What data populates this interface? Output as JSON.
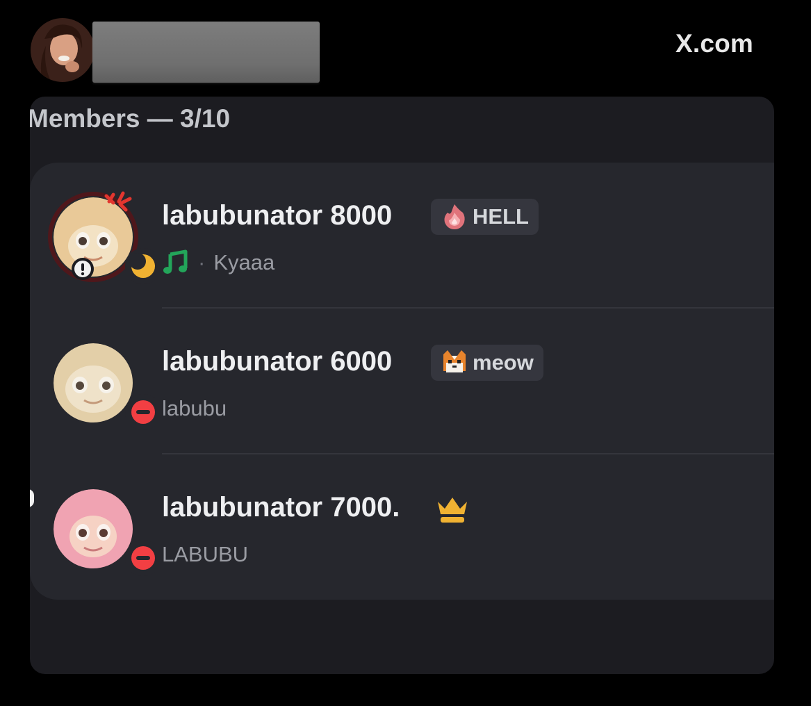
{
  "header": {
    "site_label": "X.com"
  },
  "members_panel": {
    "heading": "Members — 3/10",
    "members": [
      {
        "name": "labubunator 8000",
        "tag": "HELL",
        "tag_icon": "fire-icon",
        "activity_icon": "music-note-icon",
        "status": "Kyaaa",
        "presence": "idle",
        "avatar_color": "#e9c998"
      },
      {
        "name": "labubunator 6000",
        "tag": "meow",
        "tag_icon": "cat-icon",
        "status": "labubu",
        "presence": "do-not-disturb",
        "avatar_color": "#e3cfa8"
      },
      {
        "name": "labubunator 7000.",
        "owner_icon": "crown-icon",
        "status": "LABUBU",
        "presence": "do-not-disturb",
        "avatar_color": "#f0a3b2"
      }
    ]
  },
  "colors": {
    "background": "#000000",
    "panel": "#1c1c21",
    "card": "#26272d",
    "idle": "#f0b232",
    "dnd": "#f23f43",
    "music": "#23a55a",
    "crown": "#f0b232"
  }
}
